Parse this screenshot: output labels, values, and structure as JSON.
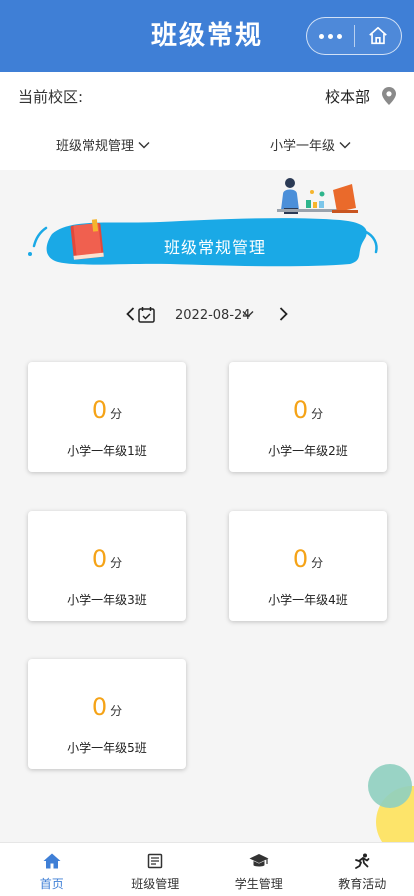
{
  "header": {
    "title": "班级常规"
  },
  "campus": {
    "label": "当前校区:",
    "value": "校本部"
  },
  "filters": {
    "category": "班级常规管理",
    "grade": "小学一年级"
  },
  "banner": {
    "title": "班级常规管理"
  },
  "date": {
    "value": "2022-08-24"
  },
  "classes": [
    {
      "score": "0",
      "unit": "分",
      "name": "小学一年级1班"
    },
    {
      "score": "0",
      "unit": "分",
      "name": "小学一年级2班"
    },
    {
      "score": "0",
      "unit": "分",
      "name": "小学一年级3班"
    },
    {
      "score": "0",
      "unit": "分",
      "name": "小学一年级4班"
    },
    {
      "score": "0",
      "unit": "分",
      "name": "小学一年级5班"
    }
  ],
  "tabs": [
    {
      "label": "首页",
      "icon": "home-icon",
      "active": true
    },
    {
      "label": "班级管理",
      "icon": "class-icon",
      "active": false
    },
    {
      "label": "学生管理",
      "icon": "graduation-cap-icon",
      "active": false
    },
    {
      "label": "教育活动",
      "icon": "running-icon",
      "active": false
    }
  ],
  "colors": {
    "primary": "#3f7fd6",
    "score": "#f5a317",
    "banner": "#1aa9e6"
  }
}
